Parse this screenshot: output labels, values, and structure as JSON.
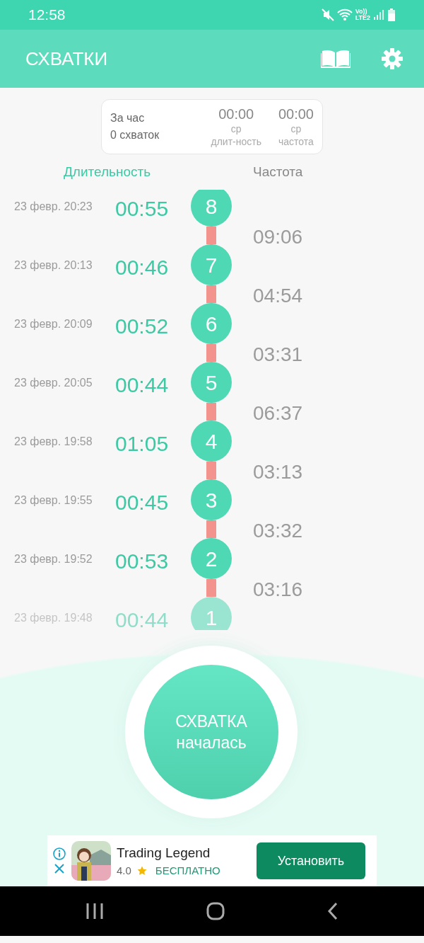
{
  "status_bar": {
    "time": "12:58",
    "volte": "Vo))",
    "network": "LTE2"
  },
  "app_bar": {
    "title": "СХВАТКИ"
  },
  "summary": {
    "period": "За час",
    "count": "0 схваток",
    "stats": [
      {
        "value": "00:00",
        "label": "ср\nдлит-ность"
      },
      {
        "value": "00:00",
        "label": "ср\nчастота"
      }
    ]
  },
  "columns": {
    "duration": "Длительность",
    "frequency": "Частота"
  },
  "contractions": [
    {
      "number": "8",
      "date": "23 февр. 20:23",
      "duration": "00:55",
      "frequency": "09:06"
    },
    {
      "number": "7",
      "date": "23 февр. 20:13",
      "duration": "00:46",
      "frequency": "04:54"
    },
    {
      "number": "6",
      "date": "23 февр. 20:09",
      "duration": "00:52",
      "frequency": "03:31"
    },
    {
      "number": "5",
      "date": "23 февр. 20:05",
      "duration": "00:44",
      "frequency": "06:37"
    },
    {
      "number": "4",
      "date": "23 февр. 19:58",
      "duration": "01:05",
      "frequency": "03:13"
    },
    {
      "number": "3",
      "date": "23 февр. 19:55",
      "duration": "00:45",
      "frequency": "03:32"
    },
    {
      "number": "2",
      "date": "23 февр. 19:52",
      "duration": "00:53",
      "frequency": "03:16"
    },
    {
      "number": "1",
      "date": "23 февр. 19:48",
      "duration": "00:44"
    }
  ],
  "start_button": {
    "line1": "СХВАТКА",
    "line2": "началась"
  },
  "ad": {
    "title": "Trading Legend",
    "rating": "4.0",
    "price": "БЕСПЛАТНО",
    "button": "Установить"
  }
}
